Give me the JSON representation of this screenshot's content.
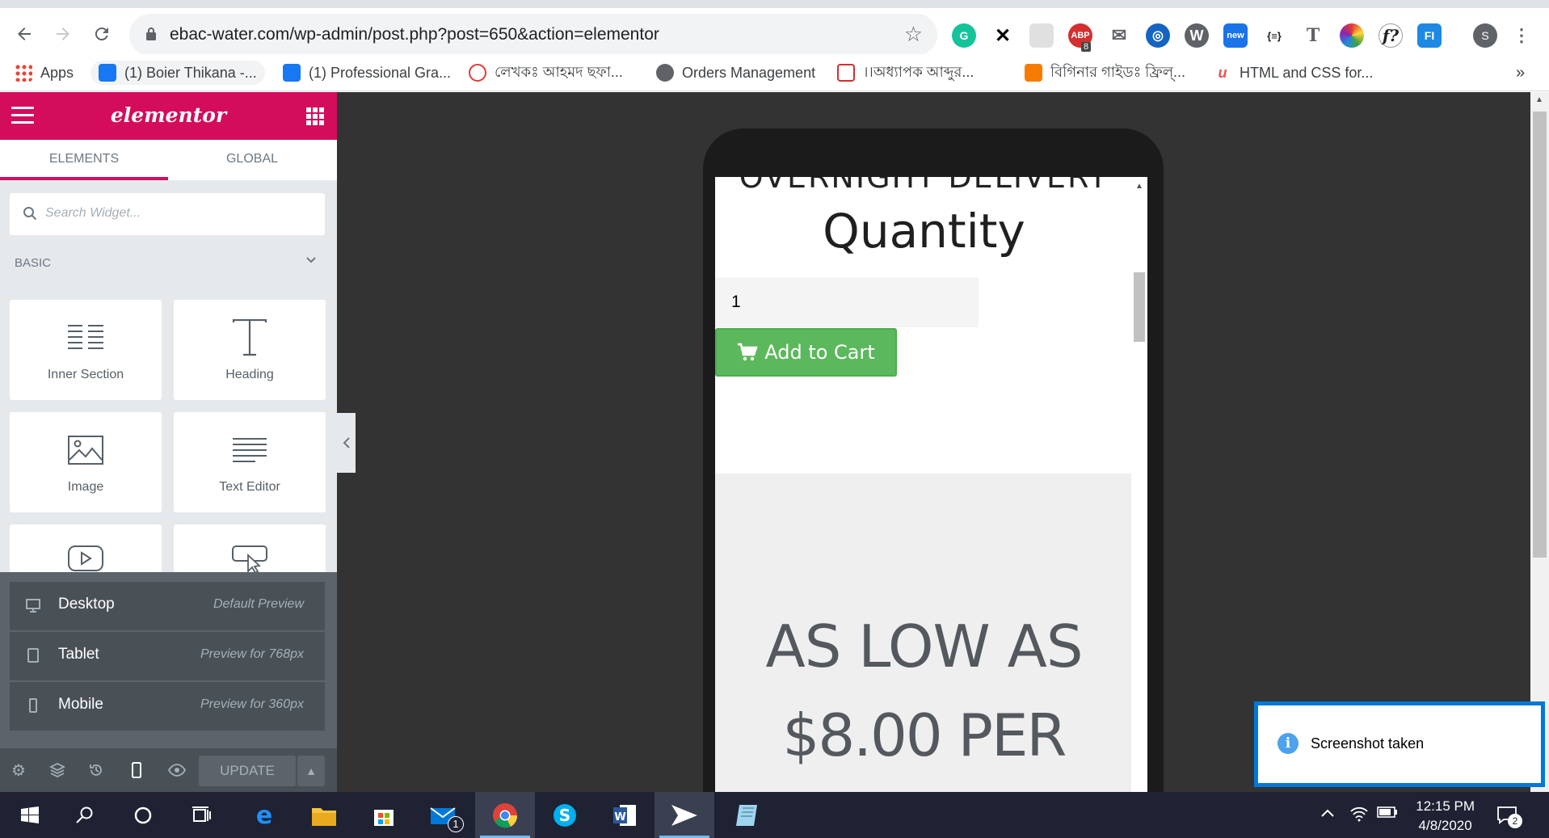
{
  "browser": {
    "url": "ebac-water.com/wp-admin/post.php?post=650&action=elementor",
    "profile_initial": "S",
    "ext_badges": {
      "adblock": "8",
      "new": "new"
    },
    "ext_labels": {
      "json": "{≡}",
      "tool_t": "T",
      "font_f": "f?",
      "fi": "FI"
    },
    "bookmarks": [
      {
        "label": "Apps"
      },
      {
        "label": "(1) Boier Thikana -..."
      },
      {
        "label": "(1) Professional Gra..."
      },
      {
        "label": "লেখকঃ আহমদ ছফা..."
      },
      {
        "label": "Orders Management"
      },
      {
        "label": "।।অধ্যাপক আব্দুর..."
      },
      {
        "label": "বিগিনার গাইডঃ ফ্রিল্..."
      },
      {
        "label": "HTML and CSS for..."
      }
    ],
    "more_bookmarks": "»"
  },
  "panel": {
    "logo": "elementor",
    "tabs": [
      {
        "label": "ELEMENTS"
      },
      {
        "label": "GLOBAL"
      }
    ],
    "search_placeholder": "Search Widget...",
    "category": "BASIC",
    "widgets": [
      {
        "label": "Inner Section",
        "icon": "inner-section-icon"
      },
      {
        "label": "Heading",
        "icon": "heading-icon"
      },
      {
        "label": "Image",
        "icon": "image-icon"
      },
      {
        "label": "Text Editor",
        "icon": "text-editor-icon"
      }
    ],
    "devices": [
      {
        "name": "Desktop",
        "desc": "Default Preview"
      },
      {
        "name": "Tablet",
        "desc": "Preview for 768px"
      },
      {
        "name": "Mobile",
        "desc": "Preview for 360px"
      }
    ],
    "footer": {
      "update_label": "UPDATE"
    }
  },
  "preview": {
    "cutoff_heading": "OVERNIGHT DELIVERY",
    "quantity_title": "Quantity",
    "quantity_value": "1",
    "add_to_cart": "Add to Cart",
    "promo_line1": "AS LOW AS",
    "promo_line2": "$8.00 PER"
  },
  "toast": {
    "text": "Screenshot taken"
  },
  "taskbar": {
    "time": "12:15 PM",
    "date": "4/8/2020",
    "mail_badge": "1",
    "notif_badge": "2"
  },
  "colors": {
    "elementor_brand": "#d30c5c",
    "cart_green": "#5cb85c",
    "toast_accent": "#0078d7",
    "taskbar": "#1e2232"
  }
}
